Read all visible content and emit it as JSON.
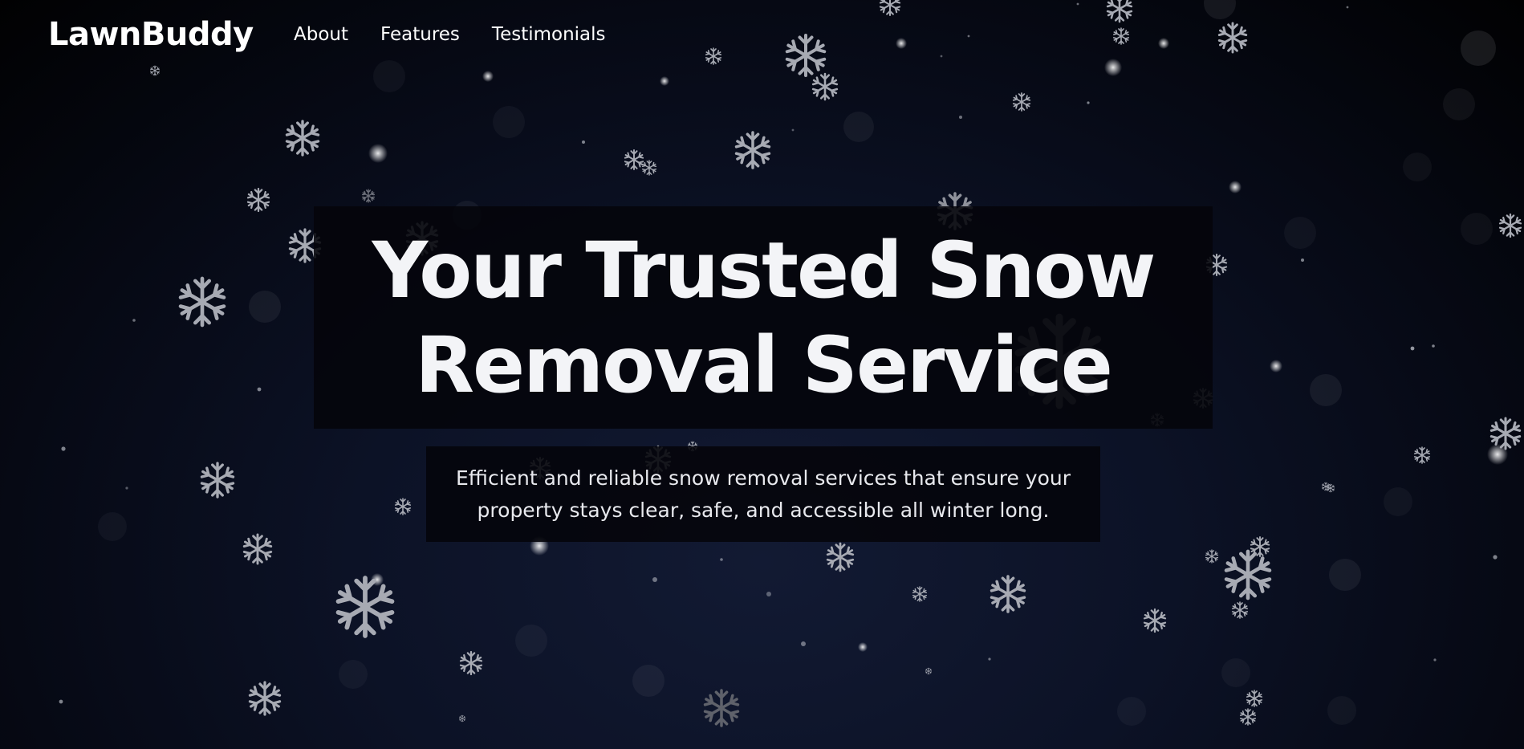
{
  "nav": {
    "brand": "LawnBuddy",
    "links": [
      {
        "label": "About"
      },
      {
        "label": "Features"
      },
      {
        "label": "Testimonials"
      }
    ]
  },
  "hero": {
    "headline": "Your Trusted Snow Removal Service",
    "subtitle": "Efficient and reliable snow removal services that ensure your property stays clear, safe, and accessible all winter long."
  },
  "decor": {
    "snowflake_icon": "snowflake-icon",
    "snow_color": "#c9ccd3",
    "text_color": "#f3f4f7",
    "background_color": "#0c1226"
  }
}
